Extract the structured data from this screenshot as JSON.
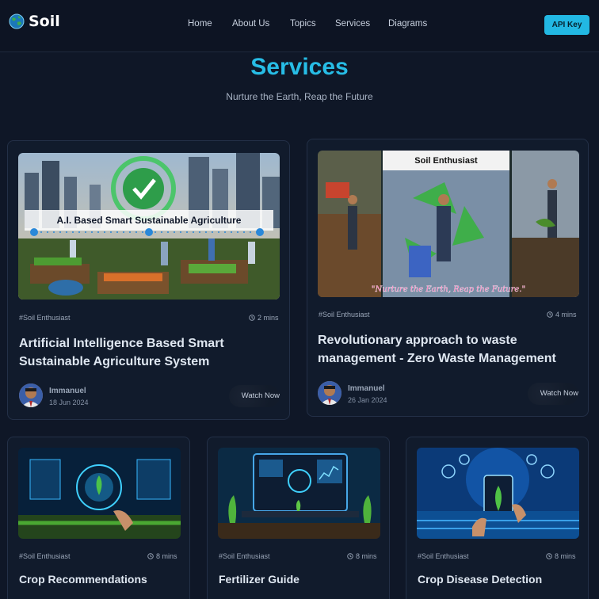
{
  "brand": {
    "name": "Soil",
    "logo_icon": "globe-icon"
  },
  "nav": {
    "links": [
      "Home",
      "About Us",
      "Topics",
      "Services",
      "Diagrams"
    ],
    "api_button": "API Key"
  },
  "hero": {
    "title": "Services",
    "subtitle": "Nurture the Earth, Reap the Future"
  },
  "featured": [
    {
      "image_caption": "A.I. Based Smart Sustainable Agriculture",
      "tag": "#Soil Enthusiast",
      "time": "2 mins",
      "title_line1": "Artificial Intelligence Based Smart",
      "title_line2": "Sustainable Agriculture System",
      "author": "Immanuel",
      "date": "18 Jun 2024",
      "action": "Watch Now"
    },
    {
      "image_header": "Soil Enthusiast",
      "image_caption": "\"Nurture the Earth, Reap the Future.\"",
      "tag": "#Soil Enthusiast",
      "time": "4 mins",
      "title_line1": "Revolutionary approach to waste",
      "title_line2": "management - Zero Waste Management",
      "author": "Immanuel",
      "date": "26 Jan 2024",
      "action": "Watch Now"
    }
  ],
  "services": [
    {
      "tag": "#Soil Enthusiast",
      "time": "8 mins",
      "title": "Crop Recommendations"
    },
    {
      "tag": "#Soil Enthusiast",
      "time": "8 mins",
      "title": "Fertilizer Guide"
    },
    {
      "tag": "#Soil Enthusiast",
      "time": "8 mins",
      "title": "Crop Disease Detection"
    }
  ],
  "colors": {
    "background": "#0f1727",
    "accent": "#27bde6",
    "api_button": "#22b8e3",
    "card": "#111b2c"
  }
}
